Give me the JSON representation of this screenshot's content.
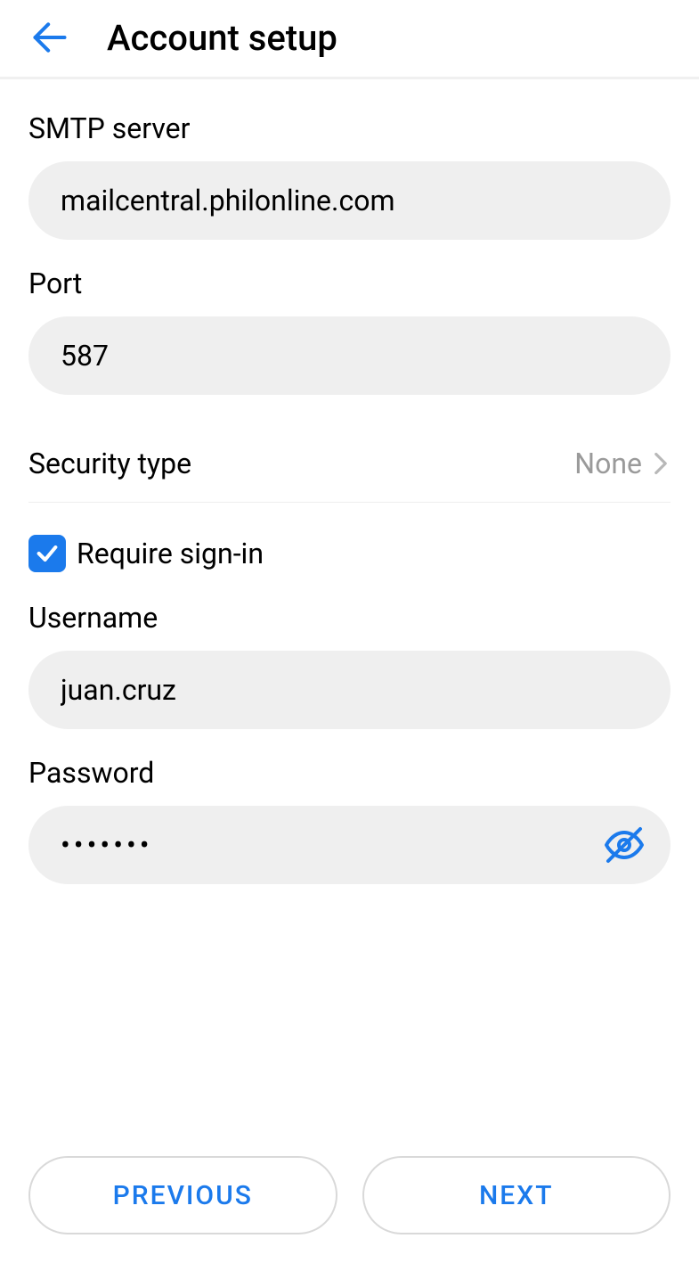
{
  "header": {
    "title": "Account setup"
  },
  "form": {
    "smtp_label": "SMTP server",
    "smtp_value": "mailcentral.philonline.com",
    "port_label": "Port",
    "port_value": "587",
    "security_label": "Security type",
    "security_value": "None",
    "require_signin_label": "Require sign-in",
    "require_signin_checked": true,
    "username_label": "Username",
    "username_value": "juan.cruz",
    "password_label": "Password",
    "password_value": "•••••••"
  },
  "footer": {
    "previous_label": "PREVIOUS",
    "next_label": "NEXT"
  },
  "colors": {
    "accent": "#1b7aec"
  }
}
